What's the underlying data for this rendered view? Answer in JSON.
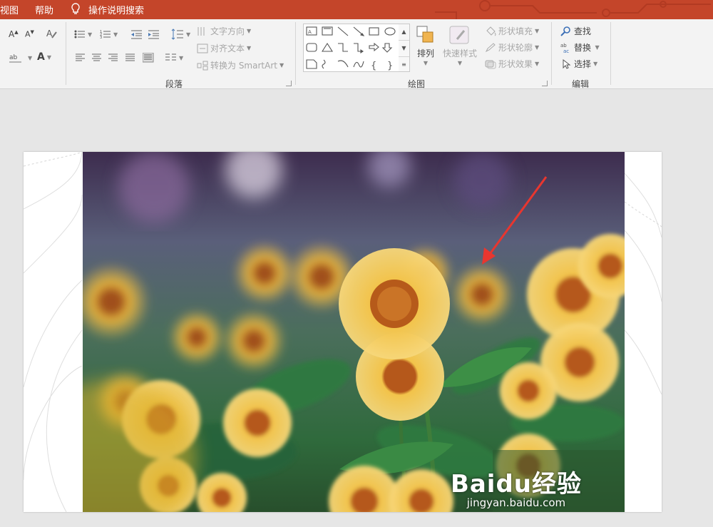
{
  "menu": {
    "items": [
      "视图",
      "帮助"
    ],
    "tell_me": "操作说明搜索"
  },
  "ribbon": {
    "paragraph": {
      "label": "段落",
      "text_direction": "文字方向",
      "align_text": "对齐文本",
      "convert_smartart": "转换为 SmartArt"
    },
    "drawing": {
      "label": "绘图",
      "arrange": "排列",
      "quick_styles": "快速样式",
      "shape_fill": "形状填充",
      "shape_outline": "形状轮廓",
      "shape_effects": "形状效果"
    },
    "editing": {
      "label": "编辑",
      "find": "查找",
      "replace": "替换",
      "select": "选择"
    }
  },
  "watermark": {
    "logo": "Baidu经验",
    "url": "jingyan.baidu.com"
  },
  "colors": {
    "accent": "#c4452a",
    "ribbon_bg": "#f3f3f3",
    "workspace_bg": "#e6e6e6",
    "arrow": "#e8362f"
  }
}
